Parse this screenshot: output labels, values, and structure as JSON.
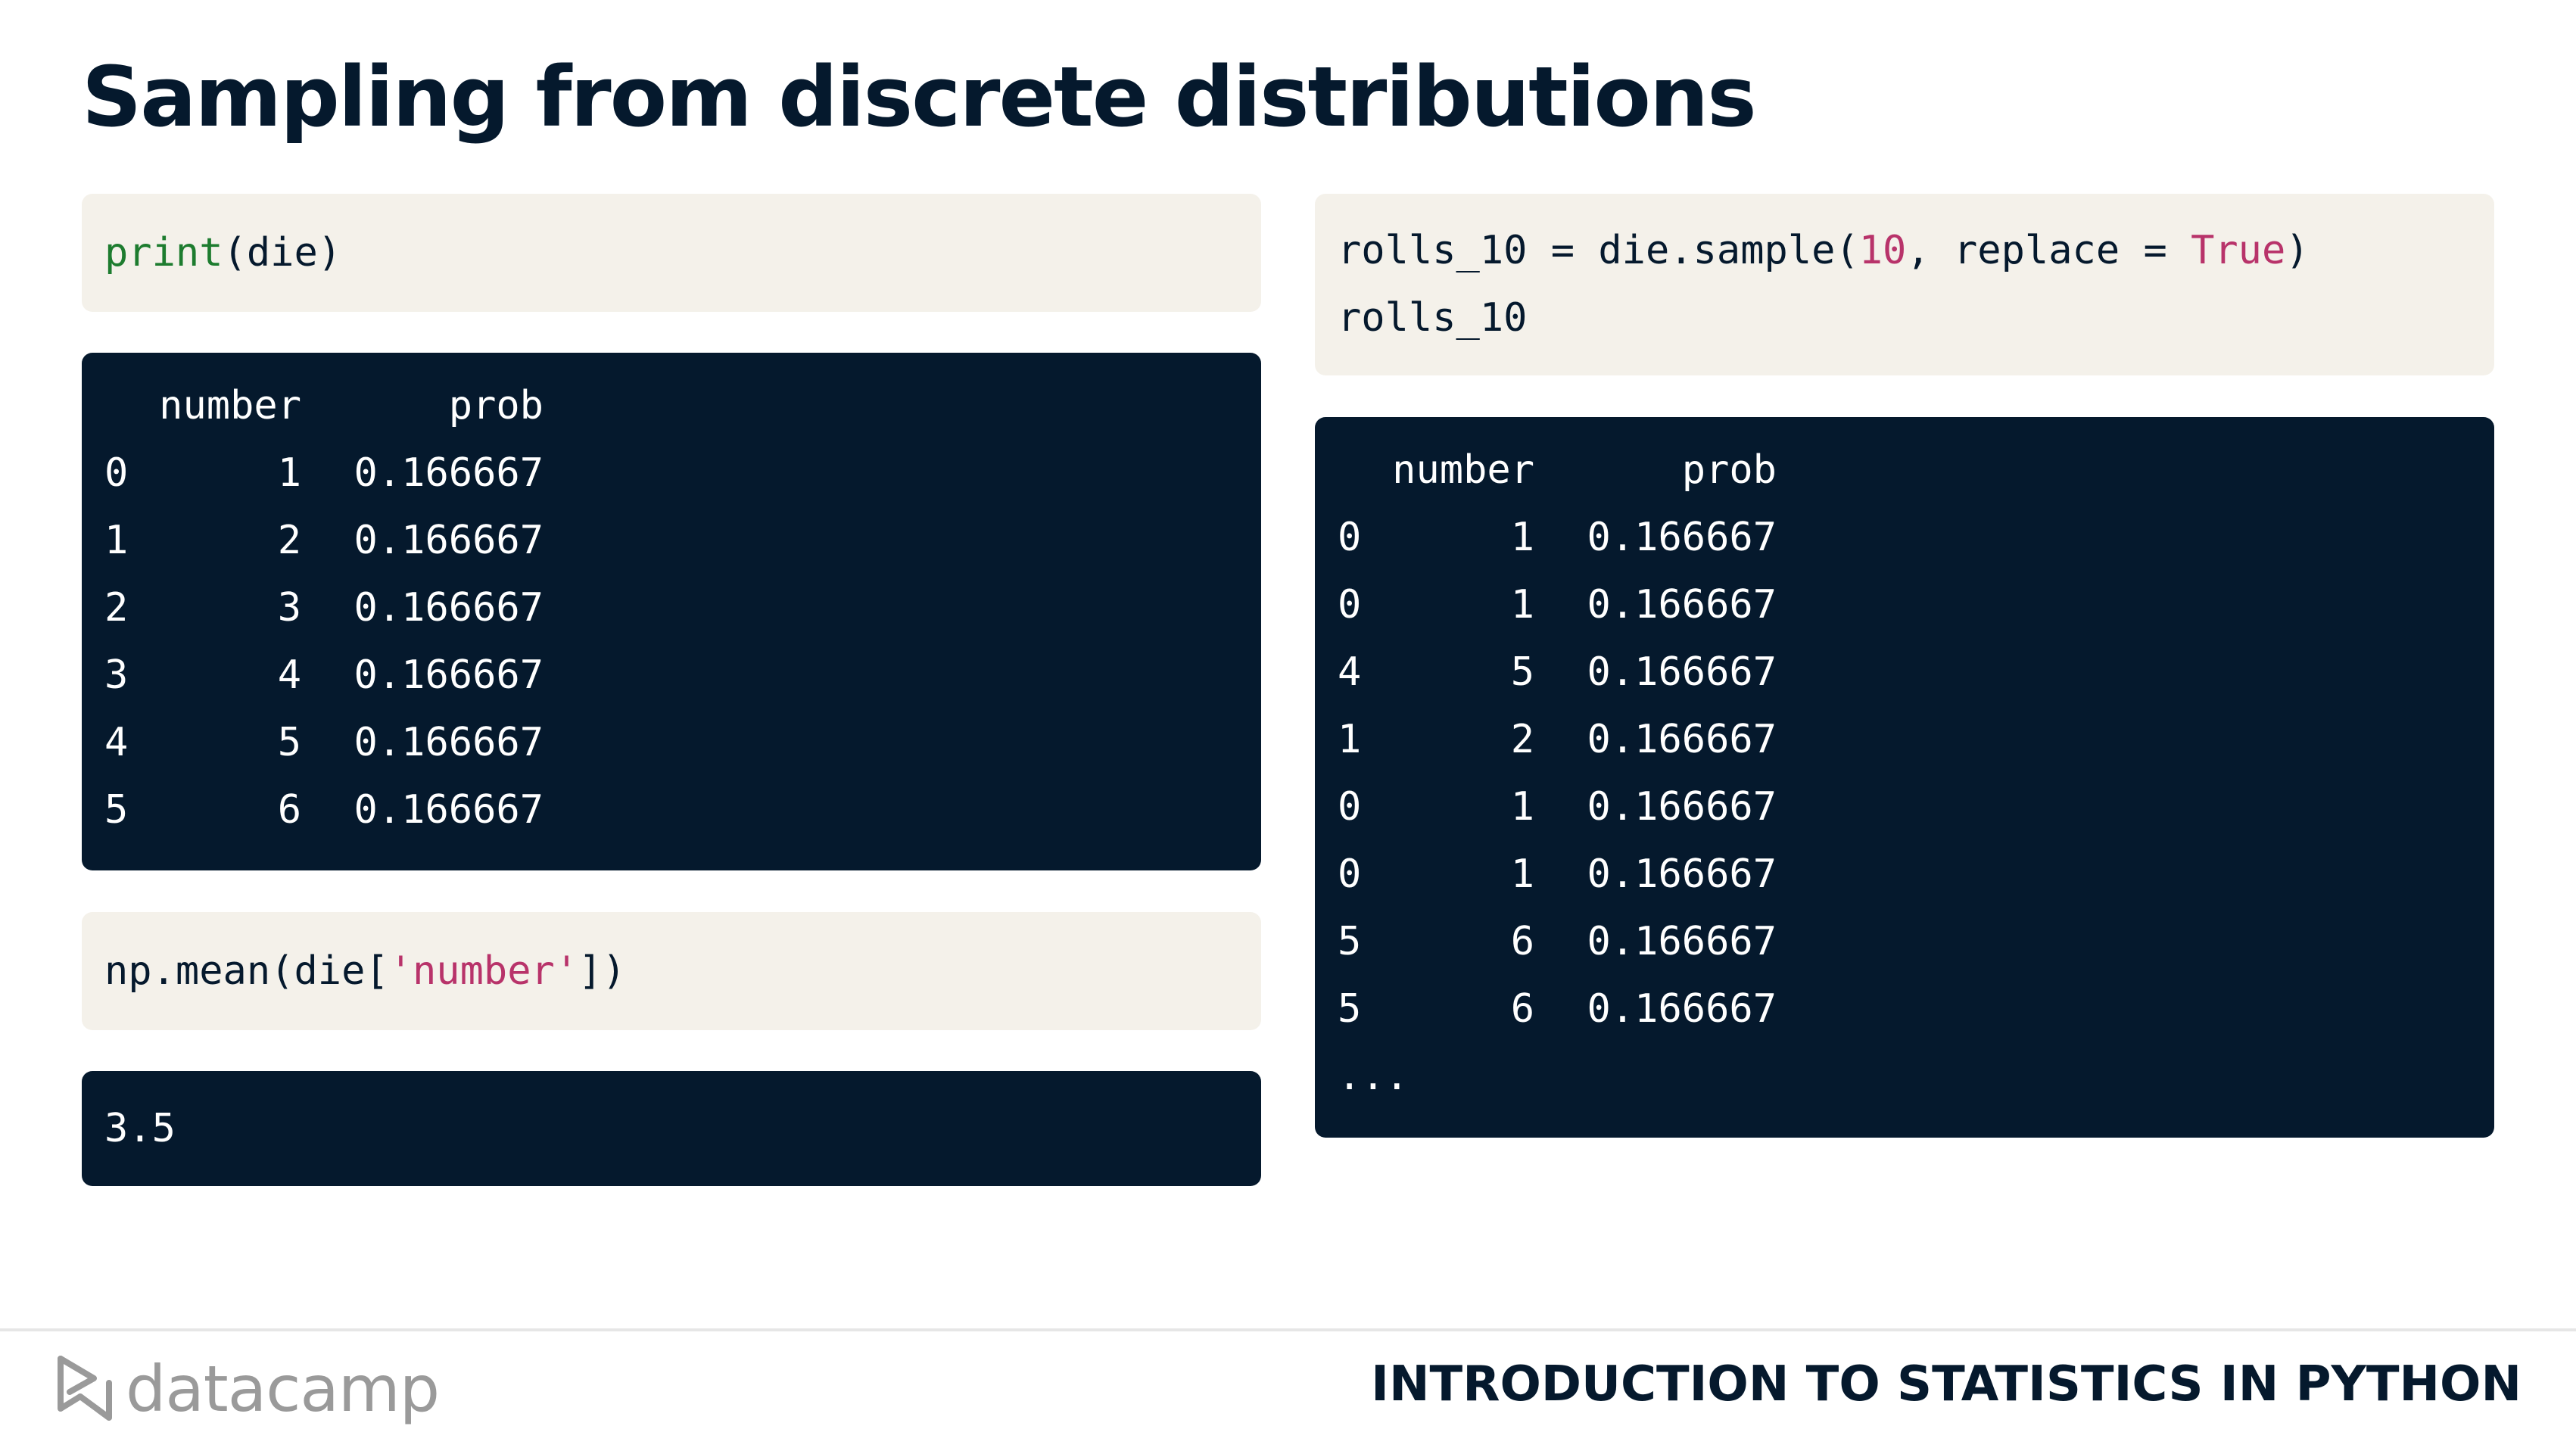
{
  "slide": {
    "title": "Sampling from discrete distributions"
  },
  "left": {
    "code1": {
      "fn": "print",
      "rest": "(die)"
    },
    "table": {
      "header": {
        "idx": "",
        "number": "number",
        "prob": "prob"
      },
      "rows": [
        {
          "idx": "0",
          "number": "1",
          "prob": "0.166667"
        },
        {
          "idx": "1",
          "number": "2",
          "prob": "0.166667"
        },
        {
          "idx": "2",
          "number": "3",
          "prob": "0.166667"
        },
        {
          "idx": "3",
          "number": "4",
          "prob": "0.166667"
        },
        {
          "idx": "4",
          "number": "5",
          "prob": "0.166667"
        },
        {
          "idx": "5",
          "number": "6",
          "prob": "0.166667"
        }
      ]
    },
    "code2": {
      "prefix": "np.mean(die[",
      "str": "'number'",
      "suffix": "])"
    },
    "output2": "3.5"
  },
  "right": {
    "code": {
      "line1_a": "rolls_10 = die.sample(",
      "line1_num": "10",
      "line1_b": ", replace = ",
      "line1_kw": "True",
      "line1_c": ")",
      "line2": "rolls_10"
    },
    "table": {
      "header": {
        "idx": "",
        "number": "number",
        "prob": "prob"
      },
      "rows": [
        {
          "idx": "0",
          "number": "1",
          "prob": "0.166667"
        },
        {
          "idx": "0",
          "number": "1",
          "prob": "0.166667"
        },
        {
          "idx": "4",
          "number": "5",
          "prob": "0.166667"
        },
        {
          "idx": "1",
          "number": "2",
          "prob": "0.166667"
        },
        {
          "idx": "0",
          "number": "1",
          "prob": "0.166667"
        },
        {
          "idx": "0",
          "number": "1",
          "prob": "0.166667"
        },
        {
          "idx": "5",
          "number": "6",
          "prob": "0.166667"
        },
        {
          "idx": "5",
          "number": "6",
          "prob": "0.166667"
        }
      ],
      "ellipsis": "..."
    }
  },
  "footer": {
    "logo_text": "datacamp",
    "course": "INTRODUCTION TO STATISTICS IN PYTHON"
  },
  "colors": {
    "navy": "#05192d",
    "code_bg": "#f4f1ea",
    "function_green": "#1d7c2f",
    "string_pink": "#b8336a",
    "logo_gray": "#9a9a9a"
  }
}
